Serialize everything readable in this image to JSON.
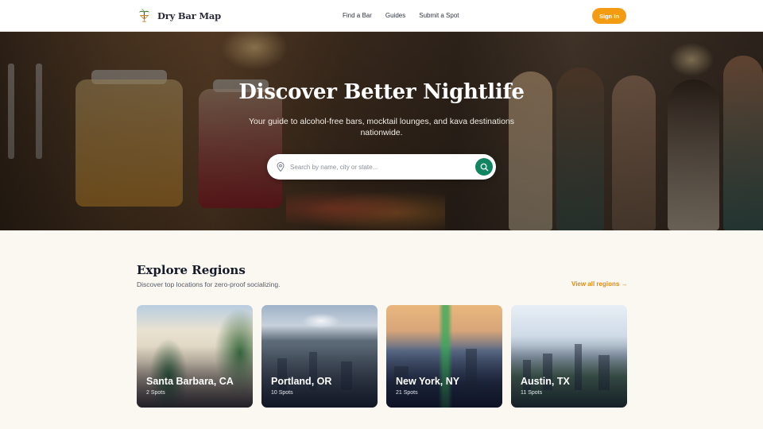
{
  "nav": {
    "brand": "Dry Bar Map",
    "links": [
      "Find a Bar",
      "Guides",
      "Submit a Spot"
    ],
    "signin_label": "Sign In"
  },
  "hero": {
    "title": "Discover Better Nightlife",
    "subtitle": "Your guide to alcohol-free bars, mocktail lounges, and kava destinations nationwide.",
    "search_placeholder": "Search by name, city or state..."
  },
  "regions": {
    "title": "Explore Regions",
    "subtitle": "Discover top locations for zero-proof socializing.",
    "view_all_label": "View all regions →",
    "cards": [
      {
        "name": "Santa Barbara, CA",
        "count": "2 Spots"
      },
      {
        "name": "Portland, OR",
        "count": "10 Spots"
      },
      {
        "name": "New York, NY",
        "count": "21 Spots"
      },
      {
        "name": "Austin, TX",
        "count": "11 Spots"
      }
    ]
  },
  "colors": {
    "accent": "#f49c11",
    "search_button": "#10855f",
    "page_bg": "#fbf8f2"
  },
  "icons": {
    "logo": "cocktail-palm-icon",
    "search_field": "map-pin-icon",
    "search_button": "search-icon"
  }
}
